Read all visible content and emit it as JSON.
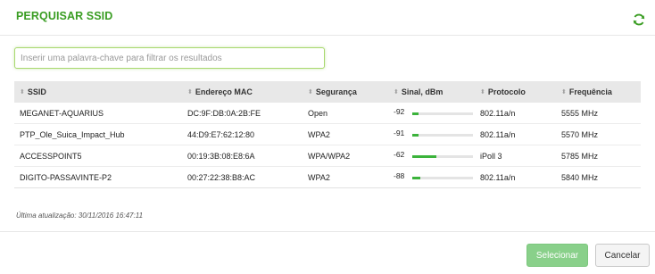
{
  "dialog": {
    "title": "PERQUISAR SSID",
    "refresh_icon": "refresh-icon",
    "accent_color": "#3a9d23"
  },
  "filter": {
    "placeholder": "Inserir uma palavra-chave para filtrar os resultados",
    "value": ""
  },
  "table": {
    "columns": [
      "SSID",
      "Endereço MAC",
      "Segurança",
      "Sinal, dBm",
      "Protocolo",
      "Frequência"
    ],
    "sort_icon": "sort-icon",
    "rows": [
      {
        "ssid": "MEGANET-AQUARIUS",
        "mac": "DC:9F:DB:0A:2B:FE",
        "security": "Open",
        "signal": "-92",
        "signal_level": 0.1,
        "protocol": "802.11a/n",
        "frequency": "5555 MHz"
      },
      {
        "ssid": "PTP_Ole_Suica_Impact_Hub",
        "mac": "44:D9:E7:62:12:80",
        "security": "WPA2",
        "signal": "-91",
        "signal_level": 0.1,
        "protocol": "802.11a/n",
        "frequency": "5570 MHz"
      },
      {
        "ssid": "ACCESSPOINT5",
        "mac": "00:19:3B:08:E8:6A",
        "security": "WPA/WPA2",
        "signal": "-62",
        "signal_level": 0.4,
        "protocol": "iPoll 3",
        "frequency": "5785 MHz"
      },
      {
        "ssid": "DIGITO-PASSAVINTE-P2",
        "mac": "00:27:22:38:B8:AC",
        "security": "WPA2",
        "signal": "-88",
        "signal_level": 0.13,
        "protocol": "802.11a/n",
        "frequency": "5840 MHz"
      }
    ],
    "signal_color": "#3bb33b"
  },
  "footer": {
    "last_update": "Última atualização: 30/11/2016 16:47:11",
    "select_label": "Selecionar",
    "cancel_label": "Cancelar",
    "select_color": "#89d08a"
  }
}
